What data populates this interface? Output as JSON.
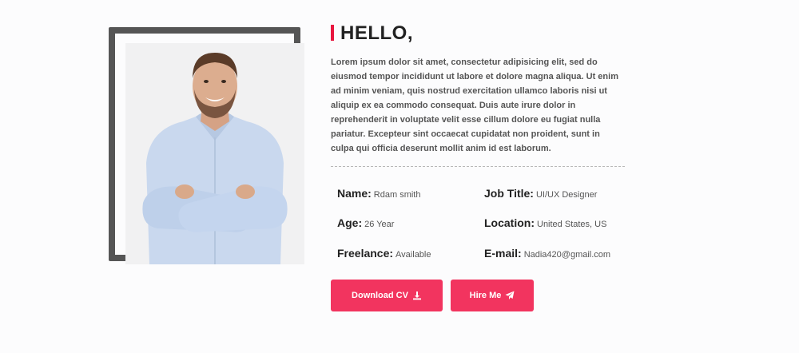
{
  "about": {
    "heading": "HELLO,",
    "intro": "Lorem ipsum dolor sit amet, consectetur adipisicing elit, sed do eiusmod tempor incididunt ut labore et dolore magna aliqua. Ut enim ad minim veniam, quis nostrud exercitation ullamco laboris nisi ut aliquip ex ea commodo consequat. Duis aute irure dolor in reprehenderit in voluptate velit esse cillum dolore eu fugiat nulla pariatur. Excepteur sint occaecat cupidatat non proident, sunt in culpa qui officia deserunt mollit anim id est laborum."
  },
  "info": {
    "name_label": "Name:",
    "name_value": "Rdam smith",
    "job_label": "Job Title:",
    "job_value": "UI/UX Designer",
    "age_label": "Age:",
    "age_value": "26 Year",
    "location_label": "Location:",
    "location_value": "United States, US",
    "freelance_label": "Freelance:",
    "freelance_value": "Available",
    "email_label": "E-mail:",
    "email_value": "Nadia420@gmail.com"
  },
  "buttons": {
    "download_label": "Download CV",
    "hire_label": "Hire Me"
  },
  "colors": {
    "accent": "#f2345f",
    "frame": "#555555"
  },
  "icons": {
    "download": "download-icon",
    "hire": "paper-plane-icon"
  }
}
